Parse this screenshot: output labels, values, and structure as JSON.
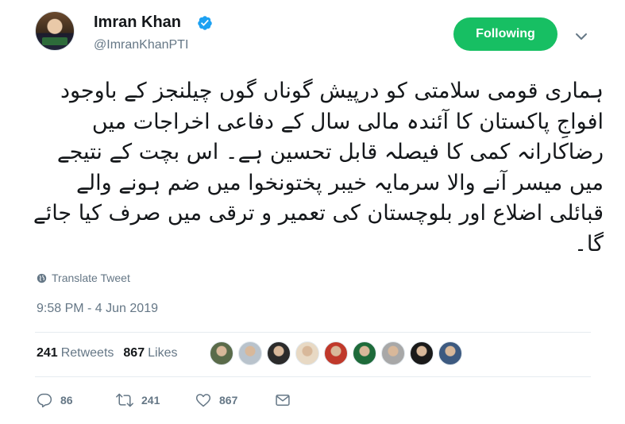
{
  "author": {
    "name": "Imran Khan",
    "handle": "@ImranKhanPTI",
    "verified_icon": "verified-badge-icon",
    "verified_color": "#1da1f2"
  },
  "follow_button": {
    "label": "Following",
    "color": "#17bf63"
  },
  "tweet": {
    "text": "ہماری قومی سلامتی کو درپیش گوناں گوں چیلنجز کے باوجود افواجِ پاکستان کا آئندہ مالی سال کے دفاعی اخراجات میں رضاکارانہ کمی کا فیصلہ قابل تحسین ہے۔ اس بچت کے نتیجے میں میسر آنے والا سرمایہ خیبر پختونخوا میں ضم ہونے والے قبائلی اضلاع اور بلوچستان کی تعمیر و ترقی میں صرف کیا جائے گا۔",
    "translate_label": "Translate Tweet",
    "timestamp": "9:58 PM - 4 Jun 2019"
  },
  "stats": {
    "retweets_count": "241",
    "retweets_label": "Retweets",
    "likes_count": "867",
    "likes_label": "Likes"
  },
  "likers": [
    {
      "color": "#5a6b4a"
    },
    {
      "color": "#b9c3cc"
    },
    {
      "color": "#2b2b2b"
    },
    {
      "color": "#e8d9c4"
    },
    {
      "color": "#c0392b"
    },
    {
      "color": "#1e6b3a"
    },
    {
      "color": "#a8a8a8"
    },
    {
      "color": "#1a1a1a"
    },
    {
      "color": "#3d5a80"
    }
  ],
  "actions": {
    "reply_count": "86",
    "retweet_count": "241",
    "like_count": "867"
  }
}
